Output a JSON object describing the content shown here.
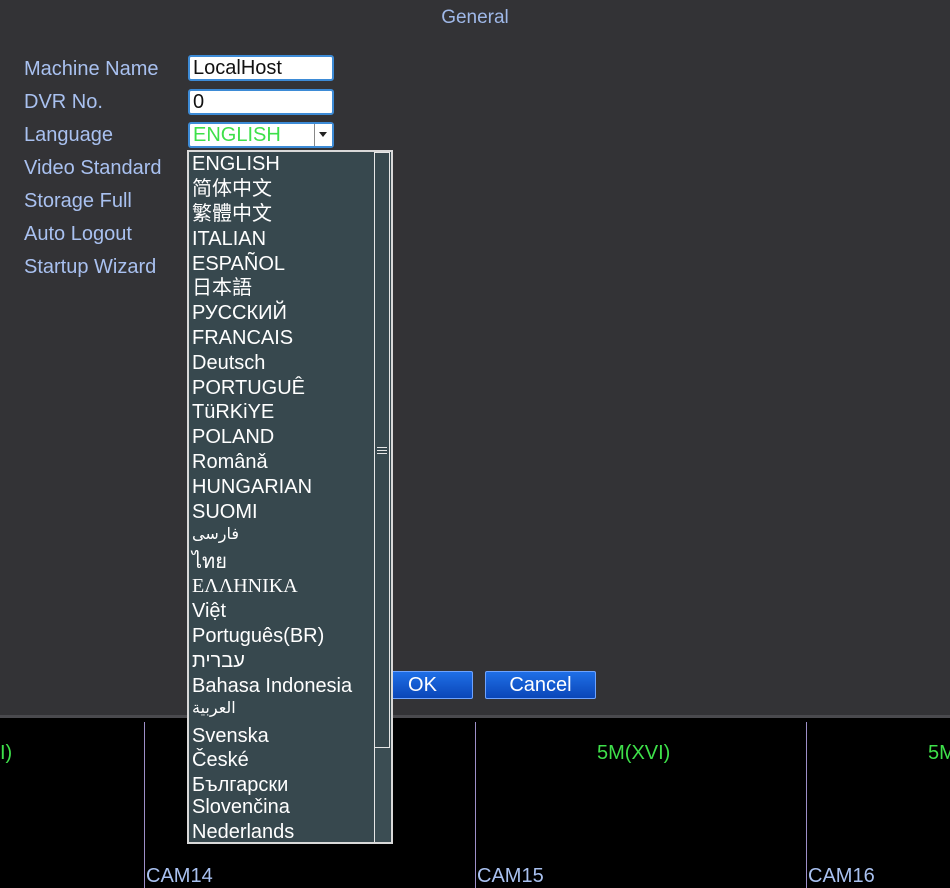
{
  "dialog": {
    "title": "General",
    "fields": {
      "machine_name_label": "Machine Name",
      "machine_name_value": "LocalHost",
      "dvr_no_label": "DVR No.",
      "dvr_no_value": "0",
      "language_label": "Language",
      "language_value": "ENGLISH",
      "video_standard_label": "Video Standard",
      "storage_full_label": "Storage Full",
      "auto_logout_label": "Auto Logout",
      "startup_wizard_label": "Startup Wizard"
    },
    "ok_label": "OK",
    "cancel_label": "Cancel"
  },
  "language_options": [
    "ENGLISH",
    "简体中文",
    "繁體中文",
    "ITALIAN",
    "ESPAÑOL",
    "日本語",
    "РУССКИЙ",
    "FRANCAIS",
    "Deutsch",
    "PORTUGUÊ",
    "TüRKiYE",
    "POLAND",
    "Românǎ",
    "HUNGARIAN",
    "SUOMI",
    "فارسی",
    "ไทย",
    "ΕΛΛΗΝΙΚΑ",
    "Việt",
    "Português(BR)",
    "עברית",
    "Bahasa Indonesia",
    "العربية",
    "Svenska",
    "České",
    "Български",
    "Slovenčina",
    "Nederlands"
  ],
  "cameras": {
    "cell1_res": "I)",
    "cell3_res": "5M(XVI)",
    "cell4_res": "5M",
    "cam14": "CAM14",
    "cam15": "CAM15",
    "cam16": "CAM16"
  },
  "colors": {
    "label": "#a9c1f0",
    "selected_value": "#3ee04a",
    "button": "#0a46b8",
    "input_border": "#3d8bd6"
  }
}
